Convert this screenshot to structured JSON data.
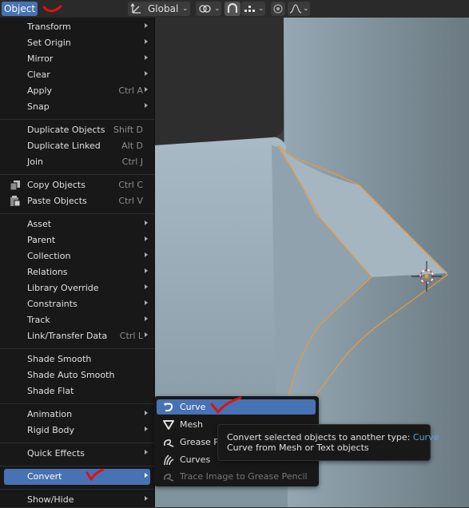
{
  "header": {
    "menu_label": "Object",
    "orientation_label": "Global"
  },
  "object_menu": {
    "items": [
      {
        "label": "Transform"
      },
      {
        "label": "Set Origin"
      },
      {
        "label": "Mirror"
      },
      {
        "label": "Clear"
      },
      {
        "label": "Apply",
        "shortcut": "Ctrl A"
      },
      {
        "label": "Snap"
      },
      {
        "label": "Duplicate Objects",
        "shortcut": "Shift D"
      },
      {
        "label": "Duplicate Linked",
        "shortcut": "Alt D"
      },
      {
        "label": "Join",
        "shortcut": "Ctrl J"
      },
      {
        "label": "Copy Objects",
        "shortcut": "Ctrl C",
        "icon": "copy-icon"
      },
      {
        "label": "Paste Objects",
        "shortcut": "Ctrl V",
        "icon": "paste-icon"
      },
      {
        "label": "Asset"
      },
      {
        "label": "Parent"
      },
      {
        "label": "Collection"
      },
      {
        "label": "Relations"
      },
      {
        "label": "Library Override"
      },
      {
        "label": "Constraints"
      },
      {
        "label": "Track"
      },
      {
        "label": "Link/Transfer Data",
        "shortcut": "Ctrl L"
      },
      {
        "label": "Shade Smooth"
      },
      {
        "label": "Shade Auto Smooth"
      },
      {
        "label": "Shade Flat"
      },
      {
        "label": "Animation"
      },
      {
        "label": "Rigid Body"
      },
      {
        "label": "Quick Effects"
      },
      {
        "label": "Convert"
      },
      {
        "label": "Show/Hide"
      }
    ]
  },
  "convert_submenu": {
    "items": [
      {
        "label": "Curve",
        "icon": "curve-icon"
      },
      {
        "label": "Mesh",
        "icon": "mesh-icon"
      },
      {
        "label": "Grease Pe",
        "icon": "grease-pencil-icon"
      },
      {
        "label": "Curves",
        "icon": "curves-icon"
      },
      {
        "label": "Trace Image to Grease Pencil",
        "icon": "trace-image-icon"
      }
    ]
  },
  "tooltip": {
    "description": "Convert selected objects to another type:",
    "operator": "Curve",
    "detail": "Curve from Mesh or Text objects"
  },
  "colors": {
    "accent": "#4772b3",
    "menu_bg": "#181818",
    "selection_outline": "#e89a3c",
    "annotation": "#e01010"
  }
}
